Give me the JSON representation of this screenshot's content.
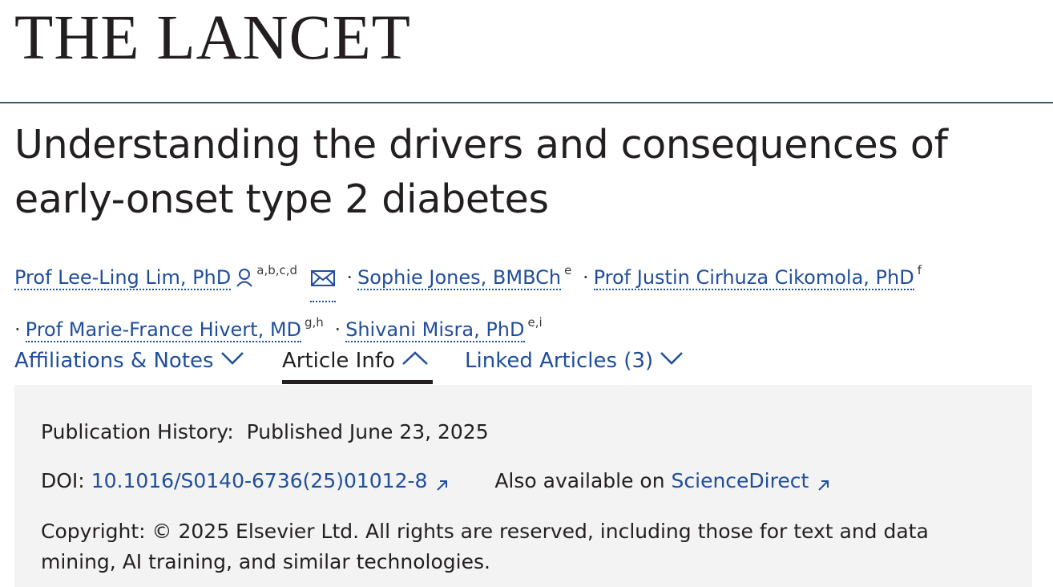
{
  "journal": {
    "name": "THE LANCET"
  },
  "article": {
    "title_line1": "Understanding the drivers and consequences of",
    "title_line2": "early-onset type 2 diabetes"
  },
  "authors": [
    {
      "name": "Prof Lee-Ling Lim, PhD",
      "affiliations": "a,b,c,d",
      "icons": [
        "person-icon",
        "email-icon"
      ]
    },
    {
      "name": "Sophie Jones, BMBCh",
      "affiliations": "e"
    },
    {
      "name": "Prof Justin Cirhuza Cikomola, PhD",
      "affiliations": "f"
    },
    {
      "name": "Prof Marie-France Hivert, MD",
      "affiliations": "g,h"
    },
    {
      "name": "Shivani Misra, PhD",
      "affiliations": "e,i"
    }
  ],
  "author_separator": "·",
  "tabs": [
    {
      "label": "Affiliations & Notes",
      "state": "collapsed"
    },
    {
      "label": "Article Info",
      "state": "expanded"
    },
    {
      "label": "Linked Articles (3)",
      "state": "collapsed"
    }
  ],
  "article_info": {
    "publication_history_label": "Publication History:",
    "publication_history_value": "Published June 23, 2025",
    "doi_label": "DOI:",
    "doi_value": "10.1016/S0140-6736(25)01012-8",
    "also_available_label": "Also available on",
    "also_available_link": "ScienceDirect",
    "copyright": "Copyright: © 2025 Elsevier Ltd. All rights are reserved, including those for text and data mining, AI training, and similar technologies."
  },
  "colors": {
    "link": "#1f4e9b",
    "text": "#231f20",
    "rule": "#3d5a6c",
    "panel_bg": "#f3f3f3"
  }
}
